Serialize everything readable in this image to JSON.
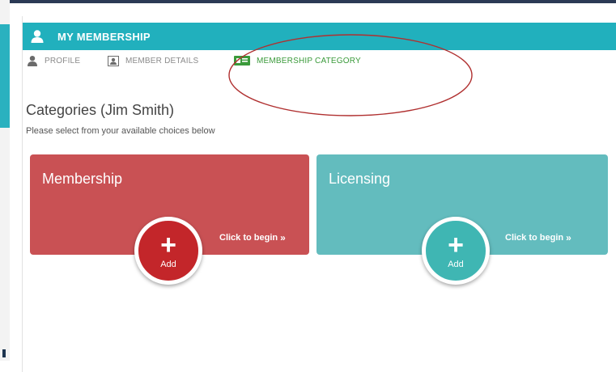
{
  "header": {
    "title": "MY MEMBERSHIP",
    "icon": "user-icon"
  },
  "tabs": [
    {
      "label": "PROFILE",
      "icon": "user-icon",
      "active": false
    },
    {
      "label": "MEMBER DETAILS",
      "icon": "id-card-icon",
      "active": false
    },
    {
      "label": "MEMBERSHIP CATEGORY",
      "icon": "id-card-icon",
      "active": true
    }
  ],
  "page": {
    "title": "Categories (Jim Smith)",
    "subtitle": "Please select from your available choices below"
  },
  "cards": [
    {
      "title": "Membership",
      "cta": "Click to begin",
      "arrow": "»",
      "add_label": "Add",
      "plus": "+"
    },
    {
      "title": "Licensing",
      "cta": "Click to begin",
      "arrow": "»",
      "add_label": "Add",
      "plus": "+"
    }
  ],
  "colors": {
    "header": "#21b0bd",
    "membership_card": "#c95154",
    "licensing_card": "#63bcbe",
    "active_tab": "#3a9a3a",
    "annotation": "#b03030"
  }
}
